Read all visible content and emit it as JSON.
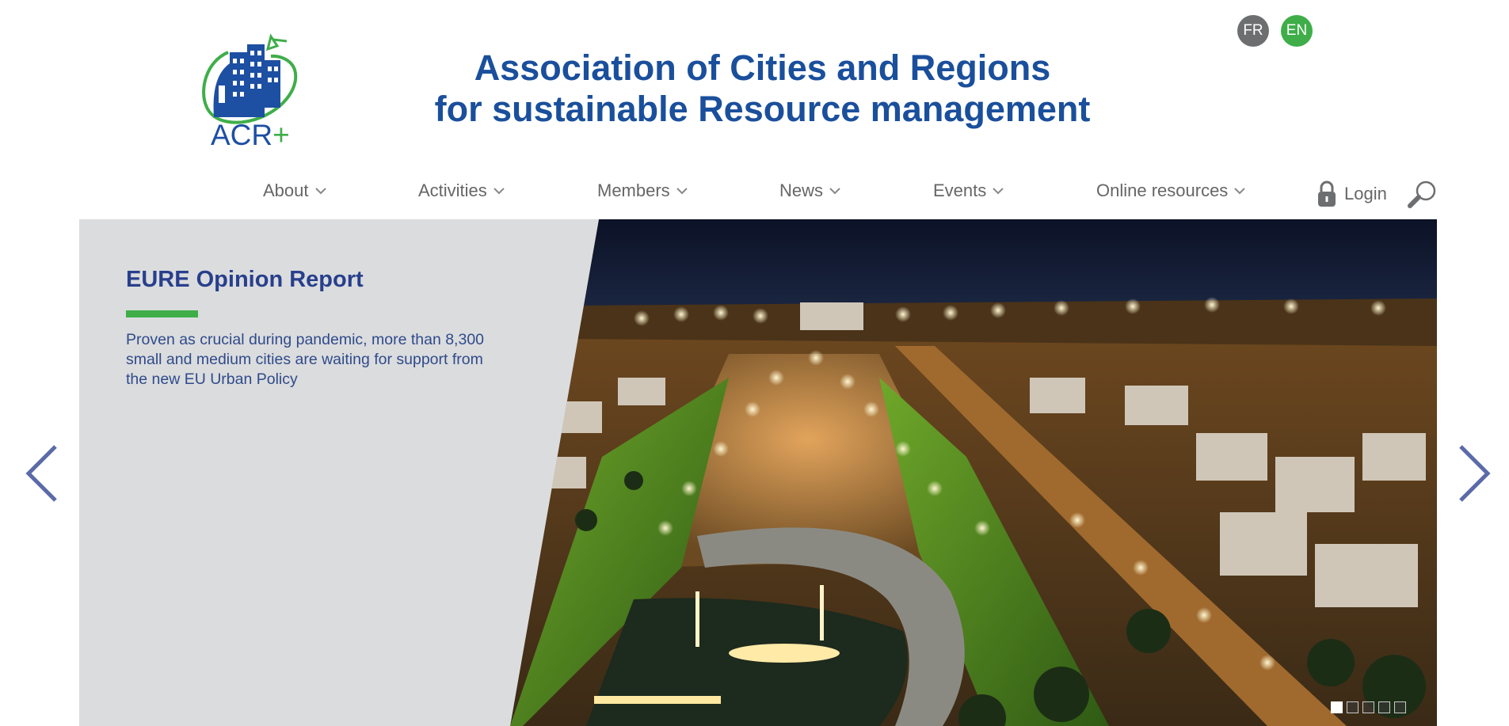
{
  "lang": {
    "fr": "FR",
    "en": "EN"
  },
  "logo": {
    "text": "ACR",
    "plus": "+"
  },
  "title": {
    "line1": "Association of Cities and Regions",
    "line2": "for sustainable Resource management"
  },
  "nav": {
    "items": [
      {
        "label": "About"
      },
      {
        "label": "Activities"
      },
      {
        "label": "Members"
      },
      {
        "label": "News"
      },
      {
        "label": "Events"
      },
      {
        "label": "Online resources"
      }
    ],
    "login": "Login"
  },
  "slide": {
    "title": "EURE Opinion Report",
    "text": "Proven as crucial during pandemic, more than 8,300 small and medium cities are waiting for support from the new EU Urban Policy",
    "dots": 5,
    "active_dot": 0
  },
  "colors": {
    "brand_blue": "#1a4f9c",
    "brand_green": "#3fae49",
    "nav_gray": "#666666",
    "panel_gray": "#dbdcde",
    "arrow": "#5b6aa9"
  }
}
